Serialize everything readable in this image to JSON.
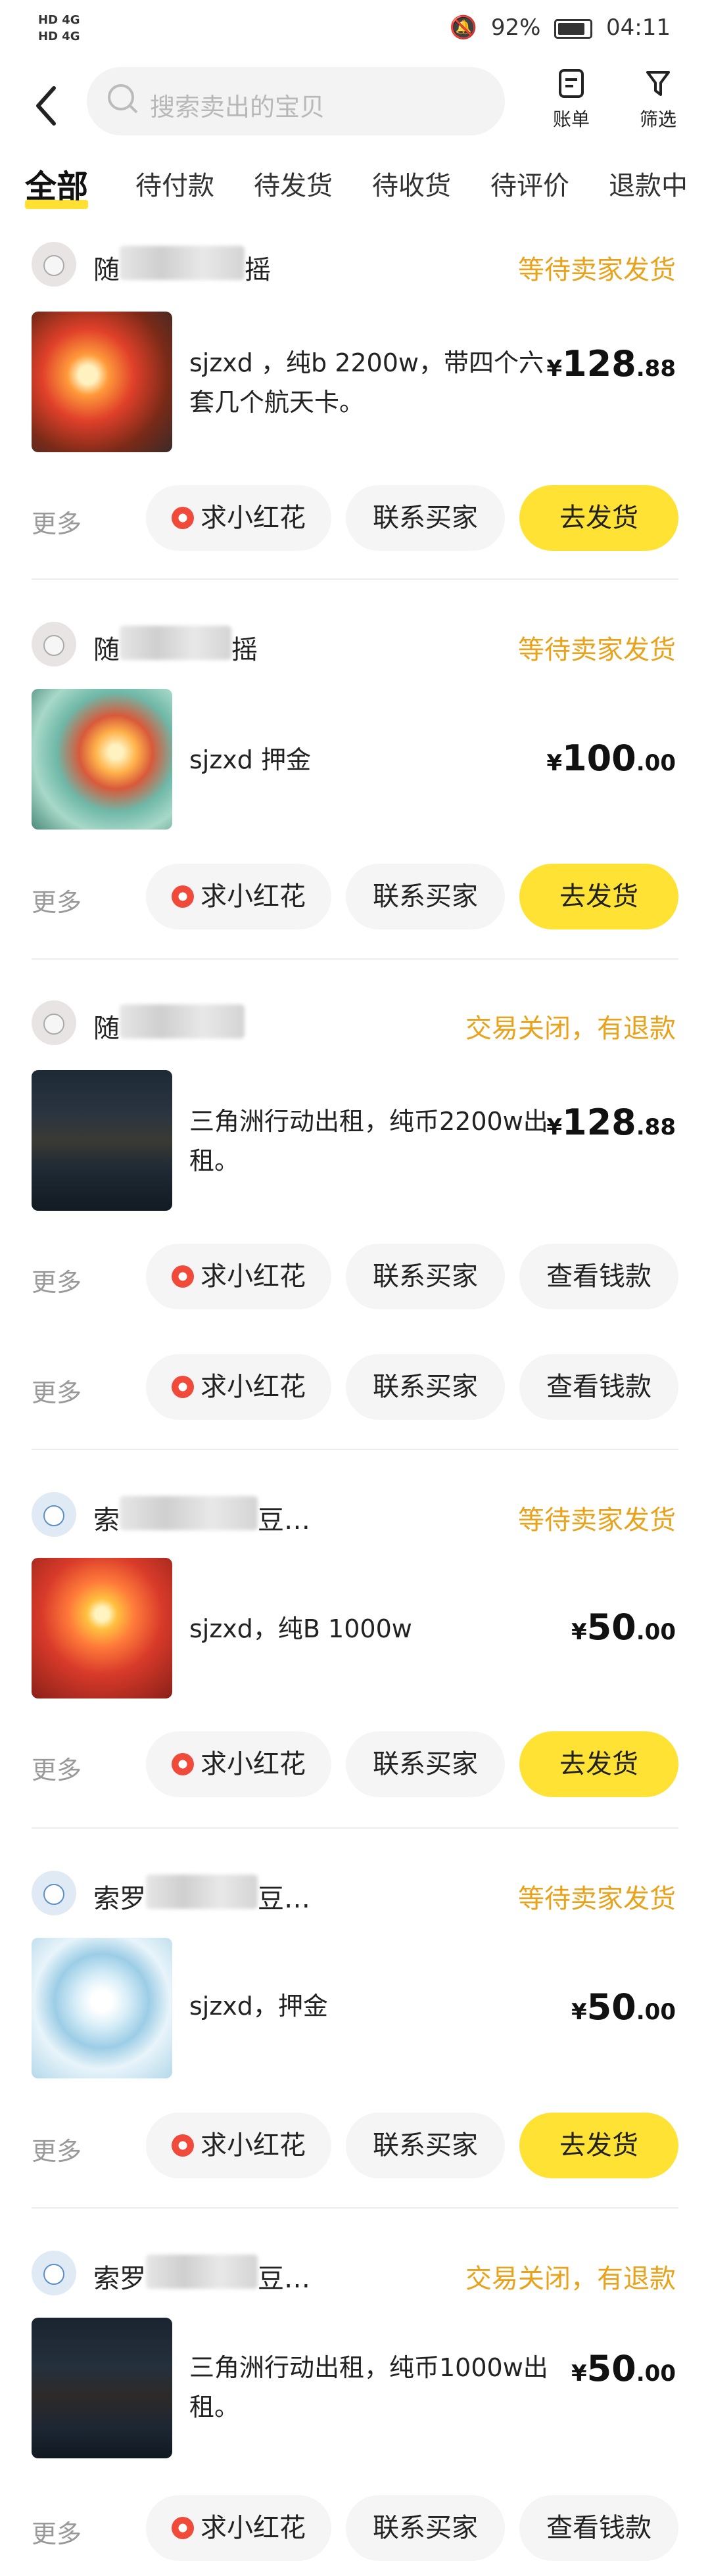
{
  "status_bar": {
    "left_top": "HD 4G",
    "left_bottom": "HD 4G",
    "battery_pct": "92%",
    "time": "04:11"
  },
  "header": {
    "search_placeholder": "搜索卖出的宝贝",
    "bill_label": "账单",
    "filter_label": "筛选"
  },
  "tabs": [
    "全部",
    "待付款",
    "待发货",
    "待收货",
    "待评价",
    "退款中"
  ],
  "common": {
    "more_label": "更多",
    "flower_label": "求小红花",
    "contact_label": "联系买家",
    "ship_label": "去发货",
    "view_money_label": "查看钱款"
  },
  "orders": [
    {
      "user_prefix": "随",
      "user_suffix": "摇",
      "status": "等待卖家发货",
      "desc": "sjzxd ，纯b 2200w，带四个六套几个航天卡。",
      "price_currency": "¥",
      "price_int": "128",
      "price_dec": ".88",
      "primary_action": "去发货"
    },
    {
      "user_prefix": "随",
      "user_suffix": "摇",
      "status": "等待卖家发货",
      "desc": "sjzxd 押金",
      "price_currency": "¥",
      "price_int": "100",
      "price_dec": ".00",
      "primary_action": "去发货"
    },
    {
      "user_prefix": "随",
      "user_suffix": "",
      "status": "交易关闭，有退款",
      "desc": "三角洲行动出租，纯币2200w出租。",
      "price_currency": "¥",
      "price_int": "128",
      "price_dec": ".88",
      "primary_action": "查看钱款",
      "extra_action_row": true
    },
    {
      "user_prefix": "索",
      "user_suffix": "豆…",
      "status": "等待卖家发货",
      "desc": "sjzxd，纯B 1000w",
      "price_currency": "¥",
      "price_int": "50",
      "price_dec": ".00",
      "primary_action": "去发货"
    },
    {
      "user_prefix": "索罗",
      "user_suffix": "豆…",
      "status": "等待卖家发货",
      "desc": "sjzxd，押金",
      "price_currency": "¥",
      "price_int": "50",
      "price_dec": ".00",
      "primary_action": "去发货"
    },
    {
      "user_prefix": "索罗",
      "user_suffix": "豆…",
      "status": "交易关闭，有退款",
      "desc": "三角洲行动出租，纯币1000w出租。",
      "price_currency": "¥",
      "price_int": "50",
      "price_dec": ".00",
      "primary_action": "查看钱款"
    }
  ],
  "colors": {
    "accent_yellow": "#ffe233",
    "status_orange": "#e8a21b",
    "flower_red": "#f04a3a"
  }
}
